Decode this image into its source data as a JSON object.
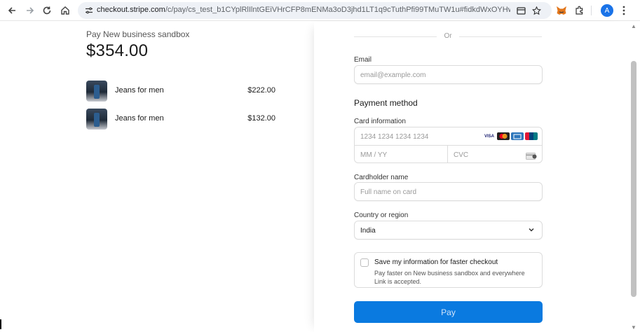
{
  "browser": {
    "url_host": "checkout.stripe.com",
    "url_path": "/c/pay/cs_test_b1CYplRlIlntGEiVHrCFP8mENMa3oD3jhd1LT1q9cTuthPfi99TMuTW1u#fidkdWxOYHwnPyd1blpxYH...",
    "avatar_letter": "A",
    "icons": [
      "back-arrow-icon",
      "forward-arrow-icon",
      "reload-icon",
      "home-icon",
      "site-info-icon",
      "tab-search-icon",
      "bookmark-star-icon",
      "metamask-icon",
      "extensions-puzzle-icon",
      "more-menu-icon"
    ]
  },
  "summary": {
    "merchant": "Pay New business sandbox",
    "total": "$354.00",
    "items": [
      {
        "name": "Jeans for men",
        "price": "$222.00"
      },
      {
        "name": "Jeans for men",
        "price": "$132.00"
      }
    ]
  },
  "form": {
    "or_text": "Or",
    "email_label": "Email",
    "email_placeholder": "email@example.com",
    "payment_method_title": "Payment method",
    "card_info_label": "Card information",
    "card_number_placeholder": "1234 1234 1234 1234",
    "card_brands": [
      "VISA",
      "mastercard",
      "amex",
      "unionpay"
    ],
    "expiry_placeholder": "MM / YY",
    "cvc_placeholder": "CVC",
    "cardholder_label": "Cardholder name",
    "cardholder_placeholder": "Full name on card",
    "country_label": "Country or region",
    "country_value": "India",
    "save_title": "Save my information for faster checkout",
    "save_desc": "Pay faster on New business sandbox and everywhere Link is accepted.",
    "pay_label": "Pay"
  },
  "colors": {
    "pay_button": "#0a7ae0",
    "chrome_avatar": "#1a73e8"
  }
}
